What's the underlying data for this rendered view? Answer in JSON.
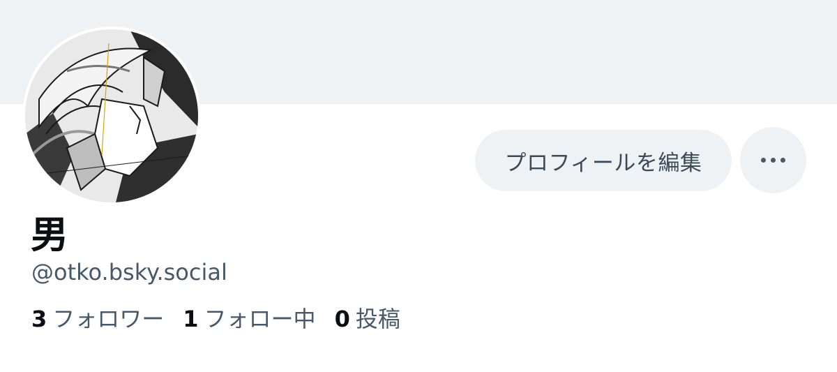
{
  "profile": {
    "display_name": "男",
    "handle": "@otko.bsky.social"
  },
  "actions": {
    "edit_profile_label": "プロフィールを編集",
    "more_icon": "ellipsis-icon"
  },
  "stats": {
    "followers_count": "3",
    "followers_label": "フォロワー",
    "following_count": "1",
    "following_label": "フォロー中",
    "posts_count": "0",
    "posts_label": "投稿"
  },
  "colors": {
    "banner": "#eef2f4",
    "button_bg": "#eef2f4",
    "text_primary": "#0b0f14",
    "text_secondary": "#46586a"
  }
}
